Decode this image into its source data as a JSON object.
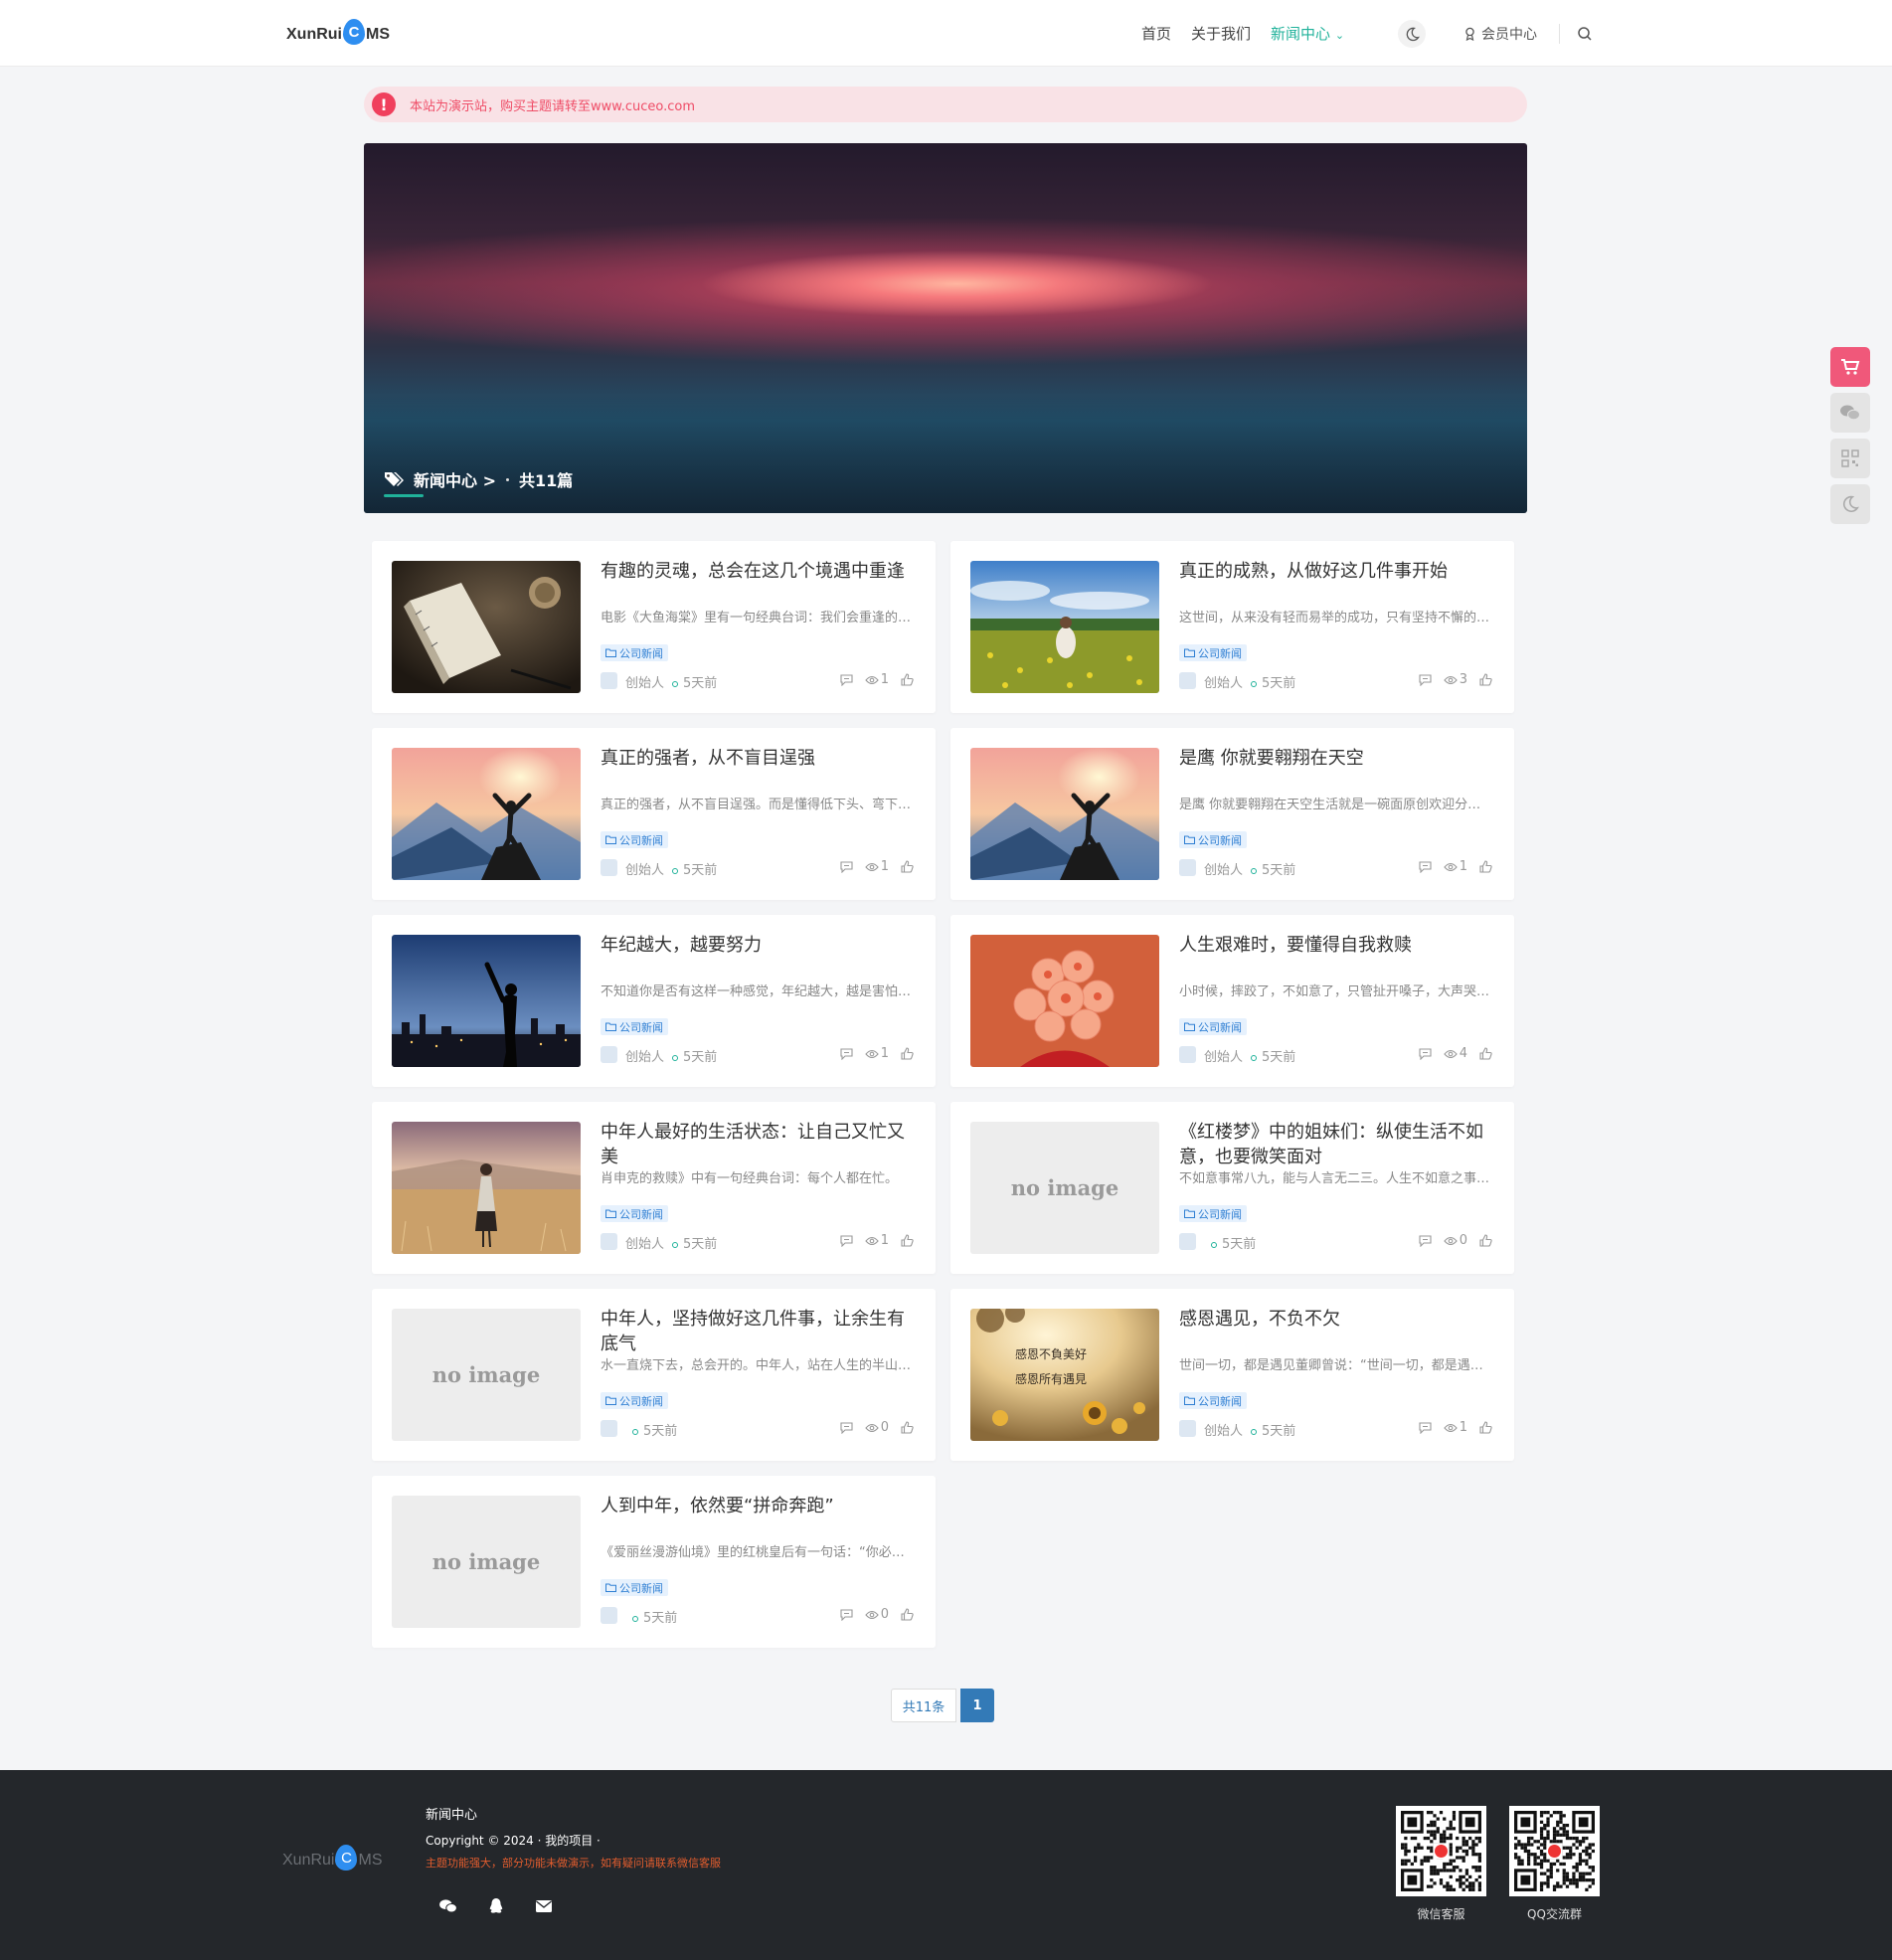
{
  "header": {
    "logo_text_left": "XunRui",
    "logo_text_c": "C",
    "logo_text_right": "MS",
    "nav": [
      {
        "label": "首页"
      },
      {
        "label": "关于我们"
      },
      {
        "label": "新闻中心",
        "active": true
      }
    ],
    "member_label": "会员中心"
  },
  "notice": {
    "text": "本站为演示站，购买主题请转至www.cuceo.com"
  },
  "banner": {
    "category": "新闻中心 >",
    "count": "共11篇"
  },
  "articles": [
    {
      "title": "有趣的灵魂，总会在这几个境遇中重逢",
      "desc": "电影《大鱼海棠》里有一句经典台词：我们会重逢的，在另一个地方。",
      "tag": "公司新闻",
      "author": "创始人",
      "time": "5天前",
      "views": "1",
      "image": "book"
    },
    {
      "title": "真正的成熟，从做好这几件事开始",
      "desc": "这世间，从来没有轻而易举的成功，只有坚持不懈的努力。",
      "tag": "公司新闻",
      "author": "创始人",
      "time": "5天前",
      "views": "3",
      "image": "field"
    },
    {
      "title": "真正的强者，从不盲目逞强",
      "desc": "真正的强者，从不盲目逞强。而是懂得低下头、弯下腰。",
      "tag": "公司新闻",
      "author": "创始人",
      "time": "5天前",
      "views": "1",
      "image": "peak"
    },
    {
      "title": "是鹰 你就要翱翔在天空",
      "desc": "是鹰 你就要翱翔在天空生活就是一碗面原创欢迎分享转发",
      "tag": "公司新闻",
      "author": "创始人",
      "time": "5天前",
      "views": "1",
      "image": "peak"
    },
    {
      "title": "年纪越大，越要努力",
      "desc": "不知道你是否有这样一种感觉，年纪越大，越是害怕改变。",
      "tag": "公司新闻",
      "author": "创始人",
      "time": "5天前",
      "views": "1",
      "image": "city"
    },
    {
      "title": "人生艰难时，要懂得自我救赎",
      "desc": "小时候，摔跤了，不如意了，只管扯开嗓子，大声哭出来。",
      "tag": "公司新闻",
      "author": "创始人",
      "time": "5天前",
      "views": "4",
      "image": "flower"
    },
    {
      "title": "中年人最好的生活状态：让自己又忙又美",
      "desc": "肖申克的救赎》中有一句经典台词：每个人都在忙。",
      "tag": "公司新闻",
      "author": "创始人",
      "time": "5天前",
      "views": "1",
      "image": "meadow"
    },
    {
      "title": "《红楼梦》中的姐妹们：纵使生活不如意，也要微笑面对",
      "desc": "不如意事常八九，能与人言无二三。人生不如意之事十有八九。",
      "tag": "公司新闻",
      "author": "",
      "time": "5天前",
      "views": "0",
      "image": "none"
    },
    {
      "title": "中年人，坚持做好这几件事，让余生有底气",
      "desc": "水一直烧下去，总会开的。中年人，站在人生的半山腰。",
      "tag": "公司新闻",
      "author": "",
      "time": "5天前",
      "views": "0",
      "image": "none"
    },
    {
      "title": "感恩遇见，不负不欠",
      "desc": "世间一切，都是遇见董卿曾说：“世间一切，都是遇见。”",
      "tag": "公司新闻",
      "author": "创始人",
      "time": "5天前",
      "views": "1",
      "image": "sunflower"
    },
    {
      "title": "人到中年，依然要“拼命奔跑”",
      "desc": "《爱丽丝漫游仙境》里的红桃皇后有一句话：“你必须拼命奔跑。”",
      "tag": "公司新闻",
      "author": "",
      "time": "5天前",
      "views": "0",
      "image": "none"
    }
  ],
  "no_image_text": "no image",
  "sunflower_poem_line1": "感恩不負美好",
  "sunflower_poem_line2": "感恩所有遇見",
  "pager": {
    "total": "共11条",
    "current": "1"
  },
  "footer": {
    "title": "新闻中心",
    "copyright": "Copyright © 2024 · 我的项目 ·",
    "note": "主题功能强大，部分功能未做演示，如有疑问请联系微信客服",
    "qr1_label": "微信客服",
    "qr2_label": "QQ交流群"
  },
  "colors": {
    "accent": "#20b29a",
    "notice": "#ef4d67",
    "cart": "#f0587a",
    "pager": "#337ab7",
    "footer_note": "#e35d2e"
  }
}
